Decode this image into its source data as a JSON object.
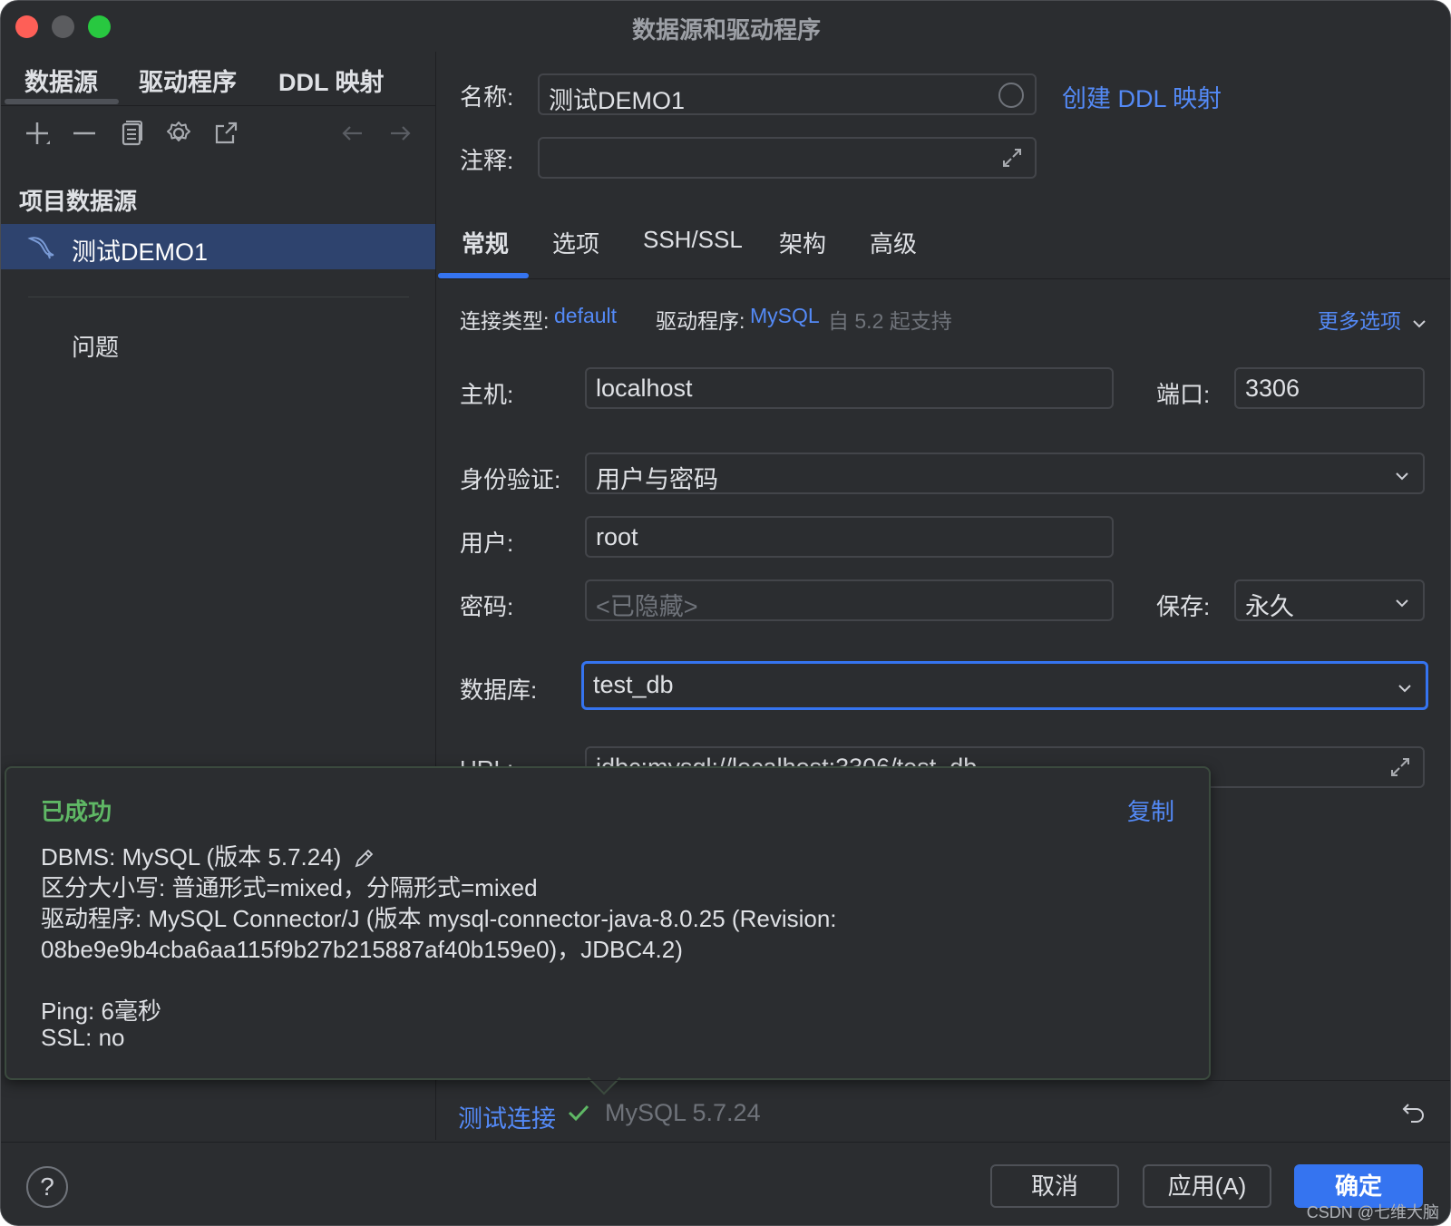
{
  "window": {
    "title": "数据源和驱动程序"
  },
  "left": {
    "tabs": [
      {
        "label": "数据源"
      },
      {
        "label": "驱动程序"
      },
      {
        "label": "DDL 映射"
      }
    ],
    "section_title": "项目数据源",
    "datasources": [
      {
        "label": "测试DEMO1",
        "icon": "mysql-dolphin-icon"
      }
    ],
    "problems_label": "问题"
  },
  "form": {
    "name_label": "名称:",
    "name_value": "测试DEMO1",
    "create_ddl_link": "创建 DDL 映射",
    "comment_label": "注释:",
    "comment_value": ""
  },
  "tabs": [
    {
      "label": "常规",
      "active": true
    },
    {
      "label": "选项"
    },
    {
      "label": "SSH/SSL"
    },
    {
      "label": "架构"
    },
    {
      "label": "高级"
    }
  ],
  "general": {
    "conn_type_label": "连接类型:",
    "conn_type_value": "default",
    "driver_label": "驱动程序:",
    "driver_value": "MySQL",
    "driver_note": "自 5.2 起支持",
    "more_options": "更多选项",
    "host_label": "主机:",
    "host_value": "localhost",
    "port_label": "端口:",
    "port_value": "3306",
    "auth_label": "身份验证:",
    "auth_value": "用户与密码",
    "user_label": "用户:",
    "user_value": "root",
    "password_label": "密码:",
    "password_placeholder": "<已隐藏>",
    "save_label": "保存:",
    "save_value": "永久",
    "database_label": "数据库:",
    "database_value": "test_db",
    "url_label": "URL:",
    "url_value": "jdbc:mysql://localhost:3306/test_db"
  },
  "popup": {
    "status": "已成功",
    "copy": "复制",
    "lines": [
      "DBMS: MySQL (版本 5.7.24)",
      "区分大小写: 普通形式=mixed，分隔形式=mixed",
      "驱动程序: MySQL Connector/J (版本 mysql-connector-java-8.0.25 (Revision:",
      "08be9e9b4cba6aa115f9b27b215887af40b159e0)，JDBC4.2)",
      "",
      "Ping: 6毫秒",
      "SSL: no"
    ]
  },
  "test": {
    "label": "测试连接",
    "result": "MySQL 5.7.24"
  },
  "footer": {
    "help": "?",
    "cancel": "取消",
    "apply": "应用(A)",
    "ok": "确定",
    "watermark": "CSDN @七维大脑"
  },
  "colors": {
    "accent": "#3574f0",
    "link": "#548af7",
    "success": "#5fb865",
    "background": "#2b2d30",
    "selection": "#2e436e"
  }
}
